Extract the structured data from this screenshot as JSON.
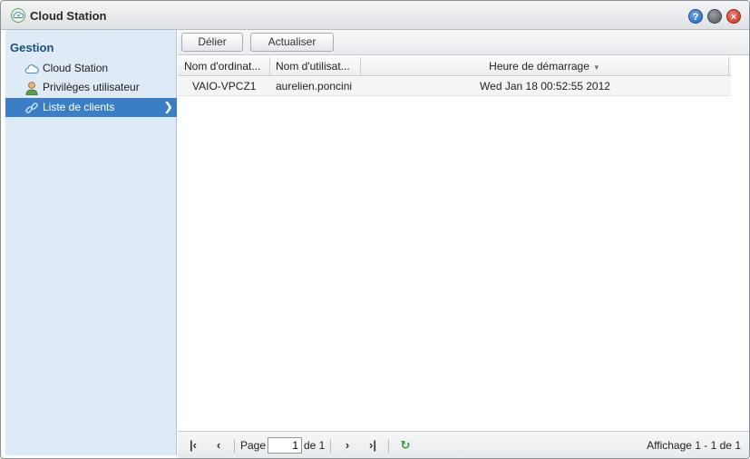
{
  "window": {
    "title": "Cloud Station",
    "help_label": "?",
    "minimize_label": "",
    "close_label": "×"
  },
  "sidebar": {
    "heading": "Gestion",
    "items": [
      {
        "label": "Cloud Station",
        "icon": "cloud-icon"
      },
      {
        "label": "Privilèges utilisateur",
        "icon": "user-icon"
      },
      {
        "label": "Liste de clients",
        "icon": "link-icon",
        "active": true
      }
    ]
  },
  "toolbar": {
    "unlink_label": "Délier",
    "refresh_label": "Actualiser"
  },
  "grid": {
    "columns": [
      "Nom d'ordinat...",
      "Nom d'utilisat...",
      "Heure de démarrage"
    ],
    "sort_indicator": "▼",
    "rows": [
      {
        "computer": "VAIO-VPCZ1",
        "user": "aurelien.poncini",
        "start_time": "Wed Jan 18 00:52:55 2012"
      }
    ]
  },
  "pager": {
    "page_label": "Page",
    "page_value": "1",
    "of_label": "de 1",
    "status": "Affichage 1 - 1 de 1"
  },
  "colors": {
    "accent": "#3a7fc6",
    "sidebar_bg": "#dfeaf7",
    "heading": "#1d4f7c"
  }
}
